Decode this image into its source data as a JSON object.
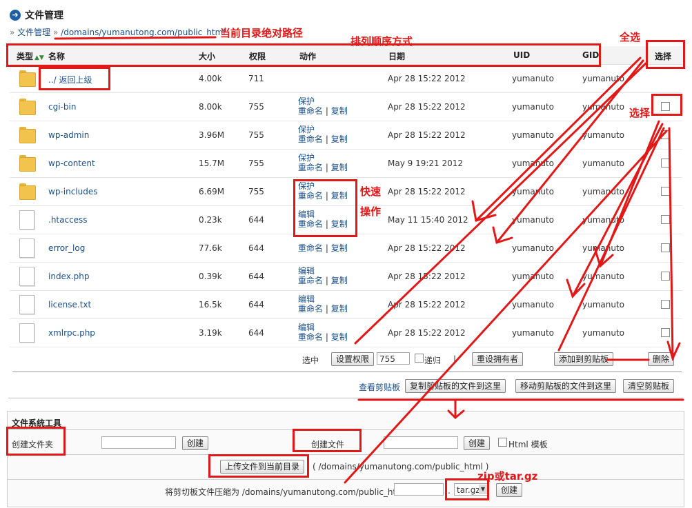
{
  "page_title": "文件管理",
  "breadcrumb": {
    "root": "文件管理",
    "path": "/domains/yumanutong.com/public_html"
  },
  "columns": {
    "type": "类型",
    "name": "名称",
    "size": "大小",
    "perm": "权限",
    "action": "动作",
    "date": "日期",
    "uid": "UID",
    "gid": "GID",
    "select": "选择"
  },
  "rows": [
    {
      "kind": "folder",
      "name": "../ 返回上级",
      "size": "4.00k",
      "perm": "711",
      "actions": [],
      "date": "Apr 28 15:22 2012",
      "uid": "yumanuto",
      "gid": "yumanuto",
      "checkbox": false
    },
    {
      "kind": "folder",
      "name": "cgi-bin",
      "size": "8.00k",
      "perm": "755",
      "actions": [
        "保护",
        "重命名",
        "复制"
      ],
      "date": "Apr 28 15:22 2012",
      "uid": "yumanuto",
      "gid": "yumanuto",
      "checkbox": true
    },
    {
      "kind": "folder",
      "name": "wp-admin",
      "size": "3.96M",
      "perm": "755",
      "actions": [
        "保护",
        "重命名",
        "复制"
      ],
      "date": "Apr 28 15:22 2012",
      "uid": "yumanuto",
      "gid": "yumanuto",
      "checkbox": true
    },
    {
      "kind": "folder",
      "name": "wp-content",
      "size": "15.7M",
      "perm": "755",
      "actions": [
        "保护",
        "重命名",
        "复制"
      ],
      "date": "May 9 19:21 2012",
      "uid": "yumanuto",
      "gid": "yumanuto",
      "checkbox": true
    },
    {
      "kind": "folder",
      "name": "wp-includes",
      "size": "6.69M",
      "perm": "755",
      "actions": [
        "保护",
        "重命名",
        "复制"
      ],
      "date": "Apr 28 15:22 2012",
      "uid": "yumanuto",
      "gid": "yumanuto",
      "checkbox": true
    },
    {
      "kind": "file",
      "name": ".htaccess",
      "size": "0.23k",
      "perm": "644",
      "actions": [
        "编辑",
        "重命名",
        "复制"
      ],
      "date": "May 11 15:40 2012",
      "uid": "yumanuto",
      "gid": "yumanuto",
      "checkbox": true
    },
    {
      "kind": "file",
      "name": "error_log",
      "size": "77.6k",
      "perm": "644",
      "actions": [
        "重命名",
        "复制"
      ],
      "date": "Apr 28 15:22 2012",
      "uid": "yumanuto",
      "gid": "yumanuto",
      "checkbox": true
    },
    {
      "kind": "file",
      "name": "index.php",
      "size": "0.39k",
      "perm": "644",
      "actions": [
        "编辑",
        "重命名",
        "复制"
      ],
      "date": "Apr 28 15:22 2012",
      "uid": "yumanuto",
      "gid": "yumanuto",
      "checkbox": true
    },
    {
      "kind": "file",
      "name": "license.txt",
      "size": "16.5k",
      "perm": "644",
      "actions": [
        "编辑",
        "重命名",
        "复制"
      ],
      "date": "Apr 28 15:22 2012",
      "uid": "yumanuto",
      "gid": "yumanuto",
      "checkbox": true
    },
    {
      "kind": "file",
      "name": "xmlrpc.php",
      "size": "3.19k",
      "perm": "644",
      "actions": [
        "编辑",
        "重命名",
        "复制"
      ],
      "date": "Apr 28 15:22 2012",
      "uid": "yumanuto",
      "gid": "yumanuto",
      "checkbox": true
    }
  ],
  "selected_bar": {
    "label": "选中",
    "set_perm": "设置权限",
    "perm_value": "755",
    "recursive": "递归",
    "divider": "|",
    "reset_owner": "重设拥有者",
    "add_clipboard": "添加到剪贴板",
    "delete": "删除"
  },
  "clipboard_bar": {
    "view": "查看剪贴板",
    "copy_here": "复制剪贴板的文件到这里",
    "move_here": "移动剪贴板的文件到这里",
    "clear": "清空剪贴板"
  },
  "fs_tools": {
    "title": "文件系统工具",
    "create_folder": "创建文件夹",
    "create_btn": "创建",
    "create_file": "创建文件",
    "html_template": "Html 模板",
    "upload": "上传文件到当前目录",
    "upload_path": "( /domains/yumanutong.com/public_html )",
    "compress_label": "将剪切板文件压缩为 /domains/yumanutong.com/public_html",
    "compress_dot": ".",
    "compress_format": "tar.gz"
  },
  "annotations": {
    "current_path": "当前目录绝对路径",
    "sort_order": "排列顺序方式",
    "select_all": "全选",
    "select": "选择",
    "quick_ops_1": "快速",
    "quick_ops_2": "操作",
    "zip": "zip或tar.gz"
  },
  "colors": {
    "annotation": "#e01818",
    "link": "#1a4f8b",
    "folder": "#f2c44e",
    "title_icon": "#1d5fa6"
  }
}
